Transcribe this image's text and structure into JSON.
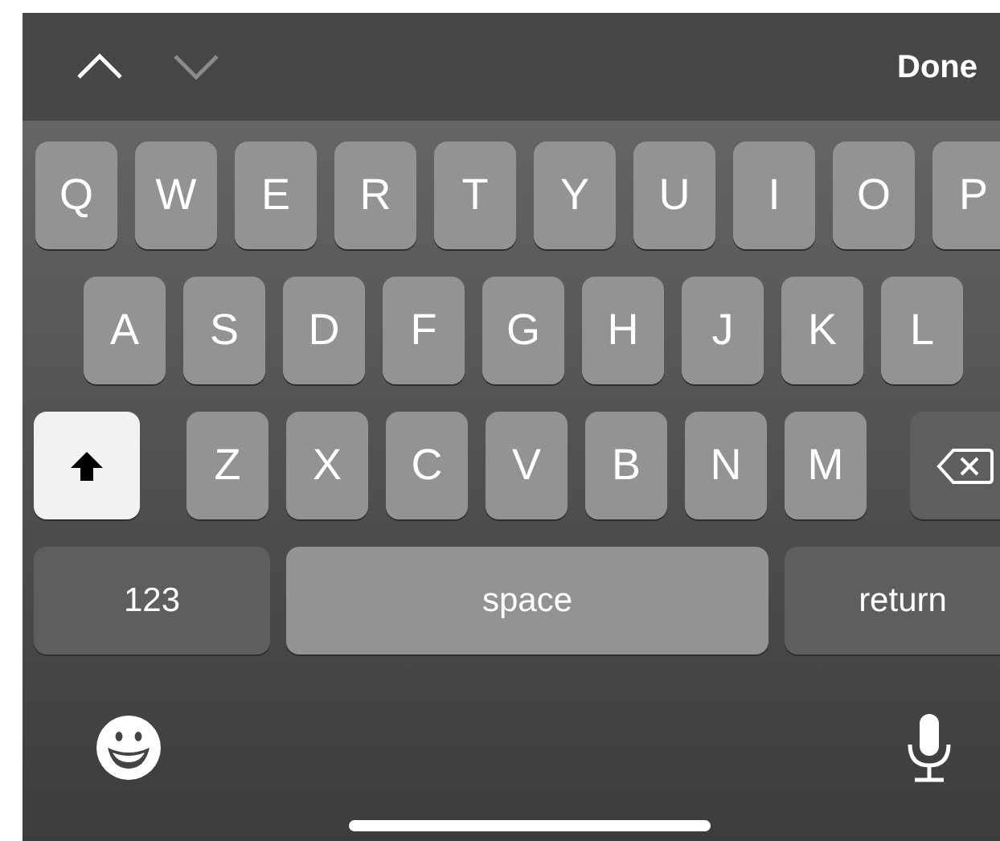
{
  "toolbar": {
    "arrows": [
      {
        "kind": "up",
        "disabled": false
      },
      {
        "kind": "down",
        "disabled": true
      }
    ],
    "done": "Done"
  },
  "rows": [
    {
      "keys": [
        {
          "kind": "letter",
          "label": "Q"
        },
        {
          "kind": "letter",
          "label": "W"
        },
        {
          "kind": "letter",
          "label": "E"
        },
        {
          "kind": "letter",
          "label": "R"
        },
        {
          "kind": "letter",
          "label": "T"
        },
        {
          "kind": "letter",
          "label": "Y"
        },
        {
          "kind": "letter",
          "label": "U"
        },
        {
          "kind": "letter",
          "label": "I"
        },
        {
          "kind": "letter",
          "label": "O"
        },
        {
          "kind": "letter",
          "label": "P"
        }
      ]
    },
    {
      "keys": [
        {
          "kind": "letter",
          "label": "A"
        },
        {
          "kind": "letter",
          "label": "S"
        },
        {
          "kind": "letter",
          "label": "D"
        },
        {
          "kind": "letter",
          "label": "F"
        },
        {
          "kind": "letter",
          "label": "G"
        },
        {
          "kind": "letter",
          "label": "H"
        },
        {
          "kind": "letter",
          "label": "J"
        },
        {
          "kind": "letter",
          "label": "K"
        },
        {
          "kind": "letter",
          "label": "L"
        }
      ]
    },
    {
      "keys": [
        {
          "kind": "shift",
          "on": true
        },
        {
          "kind": "letter",
          "label": "Z"
        },
        {
          "kind": "letter",
          "label": "X"
        },
        {
          "kind": "letter",
          "label": "C"
        },
        {
          "kind": "letter",
          "label": "V"
        },
        {
          "kind": "letter",
          "label": "B"
        },
        {
          "kind": "letter",
          "label": "N"
        },
        {
          "kind": "letter",
          "label": "M"
        },
        {
          "kind": "backspace"
        }
      ]
    },
    {
      "keys": [
        {
          "kind": "function",
          "label": "123"
        },
        {
          "kind": "space",
          "label": "space"
        },
        {
          "kind": "function",
          "label": "return"
        }
      ]
    }
  ]
}
